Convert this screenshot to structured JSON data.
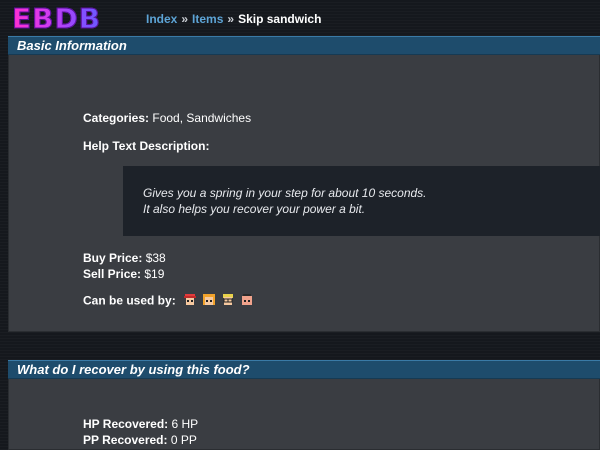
{
  "header": {
    "logo": "EBDB",
    "breadcrumb": {
      "index": "Index",
      "sep1": "»",
      "items": "Items",
      "sep2": "»",
      "current": "Skip sandwich"
    }
  },
  "basic": {
    "title": "Basic Information",
    "categories_label": "Categories:",
    "categories_value": "Food, Sandwiches",
    "help_label": "Help Text Description:",
    "help_line1": "Gives you a spring in your step for about 10 seconds.",
    "help_line2": "It also helps you recover your power a bit.",
    "buy_label": "Buy Price:",
    "buy_value": "$38",
    "sell_label": "Sell Price:",
    "sell_value": "$19",
    "usable_label": "Can be used by:",
    "characters": [
      {
        "icon": "ness-icon",
        "color": "#e23b3b"
      },
      {
        "icon": "paula-icon",
        "color": "#f2a32b"
      },
      {
        "icon": "jeff-icon",
        "color": "#e8d24a"
      },
      {
        "icon": "poo-icon",
        "color": "#f0a38c"
      }
    ]
  },
  "recover": {
    "title": "What do I recover by using this food?",
    "hp_label": "HP Recovered:",
    "hp_value": "6 HP",
    "pp_label": "PP Recovered:",
    "pp_value": "0 PP"
  }
}
